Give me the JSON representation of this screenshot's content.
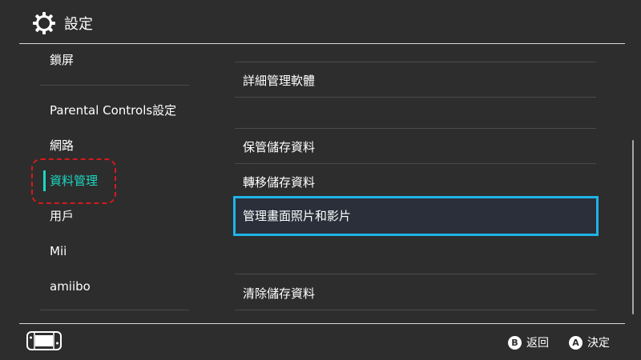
{
  "header": {
    "title": "設定",
    "icon": "gear-icon"
  },
  "sidebar": {
    "items": [
      {
        "label": "鎖屏"
      },
      {
        "label": "Parental Controls設定"
      },
      {
        "label": "網路"
      },
      {
        "label": "資料管理",
        "active": true
      },
      {
        "label": "用戶"
      },
      {
        "label": "Mii"
      },
      {
        "label": "amiibo"
      }
    ]
  },
  "main": {
    "items": [
      {
        "label": "詳細管理軟體"
      },
      {
        "label": "保管儲存資料"
      },
      {
        "label": "轉移儲存資料"
      },
      {
        "label": "管理畫面照片和影片",
        "selected": true
      },
      {
        "label": "清除儲存資料"
      }
    ]
  },
  "footer": {
    "console_icon": "switch-console-icon",
    "back": {
      "button": "B",
      "label": "返回"
    },
    "confirm": {
      "button": "A",
      "label": "決定"
    }
  },
  "colors": {
    "accent": "#1ad7c2",
    "selection": "#1fb4e8",
    "background": "#2d2d2d",
    "highlight": "#d61a1a"
  }
}
